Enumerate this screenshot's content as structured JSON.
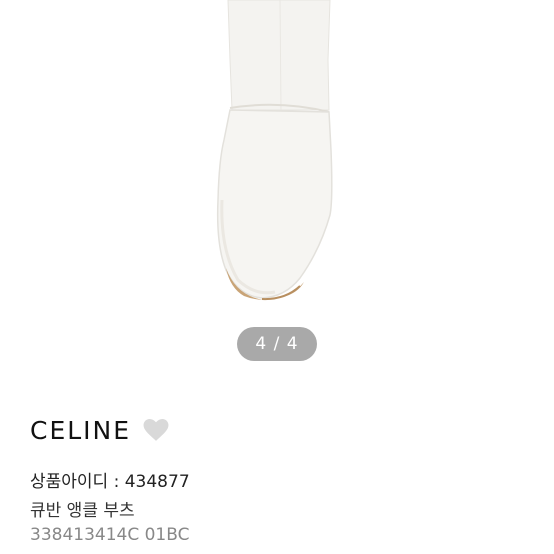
{
  "gallery": {
    "image_alt": "white ankle boot",
    "pager_current": "4",
    "pager_separator": "/",
    "pager_total": "4"
  },
  "product": {
    "brand": "CELINE",
    "id_line": "상품아이디 : 434877",
    "name": "큐반 앵클 부츠",
    "code": "338413414C 01BC"
  },
  "icons": {
    "favorite": "heart-icon"
  },
  "colors": {
    "pager_bg": "#a9a9a9",
    "heart": "#d9d9d9"
  }
}
